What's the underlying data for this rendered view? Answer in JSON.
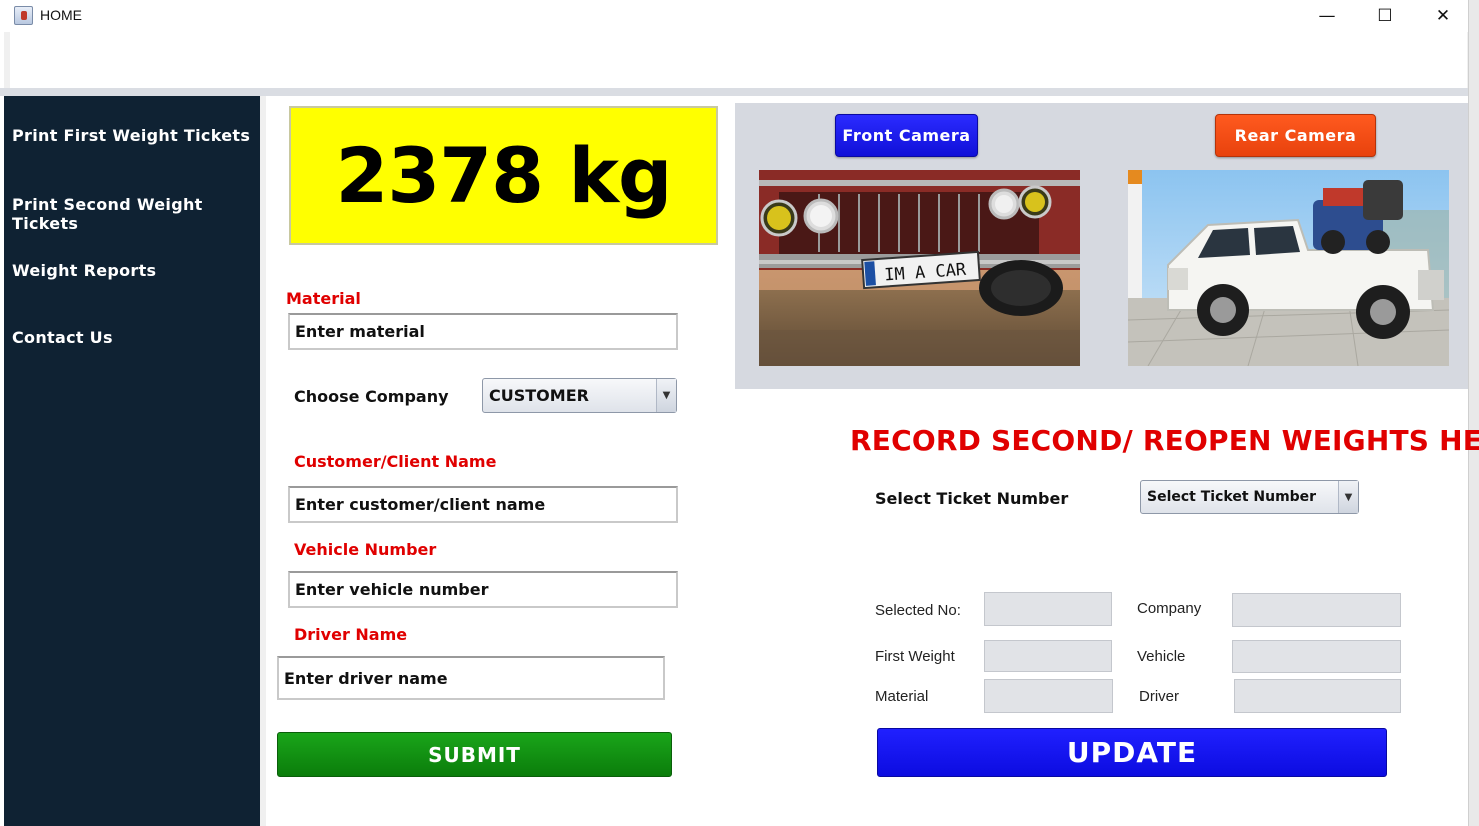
{
  "window": {
    "title": "HOME",
    "minimize": "—",
    "maximize": "☐",
    "close": "✕"
  },
  "sidebar": {
    "items": [
      {
        "label": "Print First Weight Tickets"
      },
      {
        "label": "Print Second Weight Tickets"
      },
      {
        "label": "Weight Reports"
      },
      {
        "label": "Contact Us"
      }
    ]
  },
  "scale": {
    "weight_display": "2378 kg",
    "highlight_color": "#ffff00"
  },
  "first_weight_form": {
    "material_label": "Material",
    "material_placeholder": "Enter material",
    "company_label": "Choose Company",
    "company_selected": "CUSTOMER",
    "customer_label": "Customer/Client Name",
    "customer_placeholder": "Enter customer/client name",
    "vehicle_label": "Vehicle Number",
    "vehicle_placeholder": "Enter vehicle number",
    "driver_label": "Driver Name",
    "driver_placeholder": "Enter driver name",
    "submit_label": "SUBMIT"
  },
  "cameras": {
    "front_label": "Front Camera",
    "rear_label": "Rear Camera",
    "front_plate_text": "IM A CAR"
  },
  "second_weight": {
    "title": "RECORD SECOND/ REOPEN WEIGHTS HERE",
    "ticket_label": "Select Ticket Number",
    "ticket_selected": "Select Ticket Number",
    "fields": {
      "selected_no_label": "Selected No:",
      "company_label": "Company",
      "first_weight_label": "First Weight",
      "vehicle_label": "Vehicle",
      "material_label": "Material",
      "driver_label": "Driver"
    },
    "update_label": "UPDATE"
  }
}
